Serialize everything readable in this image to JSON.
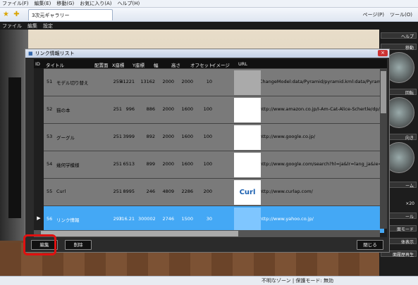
{
  "browser": {
    "menu": [
      "ファイル(F)",
      "編集(E)",
      "移動(G)",
      "お気に入り(A)",
      "ヘルプ(H)"
    ],
    "tab_title": "3次元ギャラリー",
    "toolbar_right": [
      "ページ(P)",
      "ツール(O)"
    ]
  },
  "app_menu": [
    "ファイル",
    "編集",
    "設定"
  ],
  "side_panel": {
    "help": "ヘルプ",
    "move": "移動",
    "rotate": "回転",
    "depth": "向き",
    "zoom": "ーム",
    "zoom_value": "×20",
    "tool": "ール",
    "mode": "面モード",
    "show": "体表示",
    "history": "面履歴再生"
  },
  "dialog": {
    "title": "リンク情報リスト",
    "close": "×",
    "columns": [
      "ID",
      "タイトル",
      "配置面",
      "X座標",
      "Y座標",
      "幅",
      "高さ",
      "オフセット",
      "イメージ",
      "URL"
    ],
    "rows": [
      {
        "id": "51",
        "title": "モデル切り替え",
        "face": "255",
        "x": "41221",
        "y": "13162",
        "w": "2000",
        "h": "2000",
        "off": "10",
        "img": "",
        "url": "ChangeModel:data/Pyramid/pyramid.kml:data/Pyramid/Lin"
      },
      {
        "id": "52",
        "title": "猫の本",
        "face": "251",
        "x": "996",
        "y": "886",
        "w": "2000",
        "h": "1600",
        "off": "100",
        "img": "",
        "url": "http://www.amazon.co.jp/I-Am-Cat-Alice-Schertle/dp/0688"
      },
      {
        "id": "53",
        "title": "グーグル",
        "face": "251",
        "x": "3999",
        "y": "892",
        "w": "2000",
        "h": "1600",
        "off": "100",
        "img": "",
        "url": "http://www.google.co.jp/"
      },
      {
        "id": "54",
        "title": "幾何学模様",
        "face": "251",
        "x": "6513",
        "y": "899",
        "w": "2000",
        "h": "1600",
        "off": "100",
        "img": "",
        "url": "http://www.google.com/search?hl=ja&lr=lang_ja&ie=UTF"
      },
      {
        "id": "55",
        "title": "Curl",
        "face": "251",
        "x": "8995",
        "y": "246",
        "w": "4809",
        "h": "2286",
        "off": "200",
        "img": "Curl",
        "url": "http://www.curlap.com/"
      },
      {
        "id": "56",
        "title": "リンク情報",
        "face": "293",
        "x": "716.21",
        "y": "300002",
        "w": "2746",
        "h": "1500",
        "off": "30",
        "img": "",
        "url": "http://www.yahoo.co.jp/"
      }
    ],
    "selected_marker": "▶",
    "buttons": {
      "edit": "編集",
      "delete": "削除",
      "close": "閉じる"
    }
  },
  "status": "不明なゾーン | 保護モード: 無効"
}
